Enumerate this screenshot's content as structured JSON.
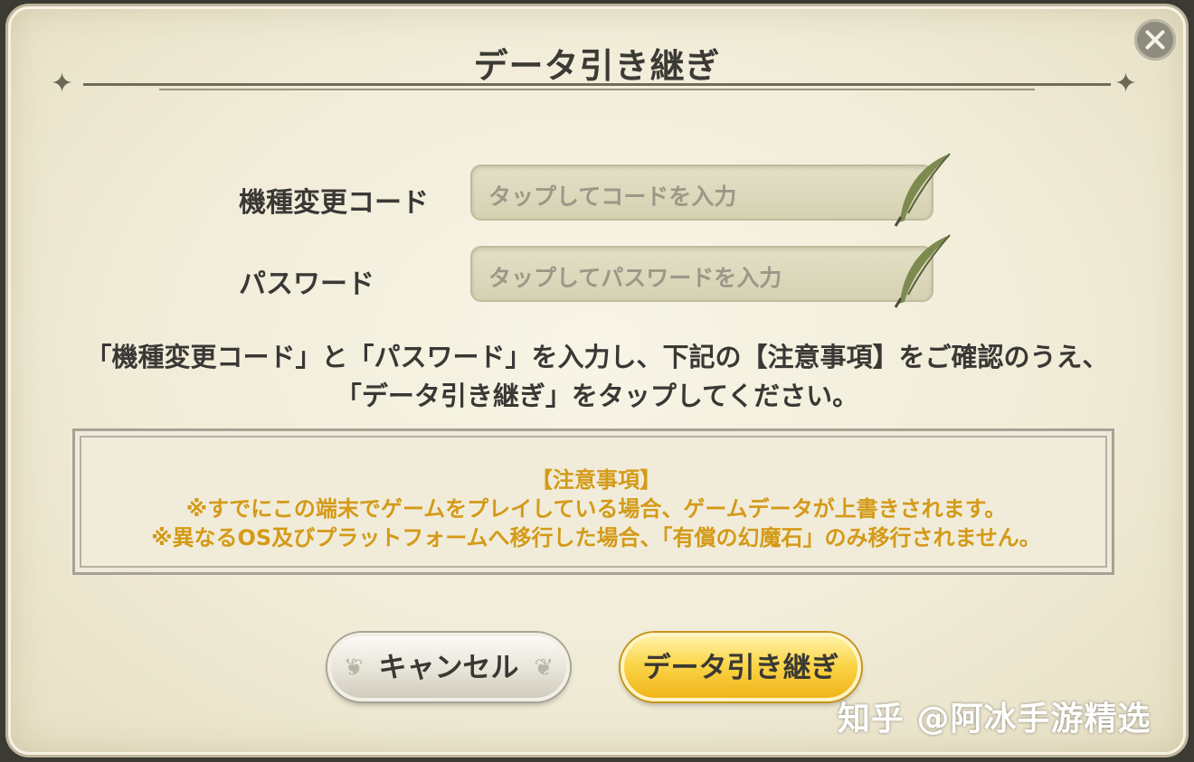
{
  "dialog": {
    "title": "データ引き継ぎ",
    "close_icon": "close-icon"
  },
  "form": {
    "code_label": "機種変更コード",
    "code_placeholder": "タップしてコードを入力",
    "password_label": "パスワード",
    "password_placeholder": "タップしてパスワードを入力",
    "input_icon": "quill-pen-icon"
  },
  "instruction": {
    "line1": "「機種変更コード」と「パスワード」を入力し、下記の【注意事項】をご確認のうえ、",
    "line2": "「データ引き継ぎ」をタップしてください。"
  },
  "notice": {
    "heading": "【注意事項】",
    "items": [
      "※すでにこの端末でゲームをプレイしている場合、ゲームデータが上書きされます。",
      "※異なるOS及びプラットフォームへ移行した場合、「有償の幻魔石」のみ移行されません。"
    ],
    "text_color": "#d49a18"
  },
  "buttons": {
    "cancel_label": "キャンセル",
    "transfer_label": "データ引き継ぎ"
  },
  "watermark": {
    "text": "知乎 @阿冰手游精选"
  }
}
